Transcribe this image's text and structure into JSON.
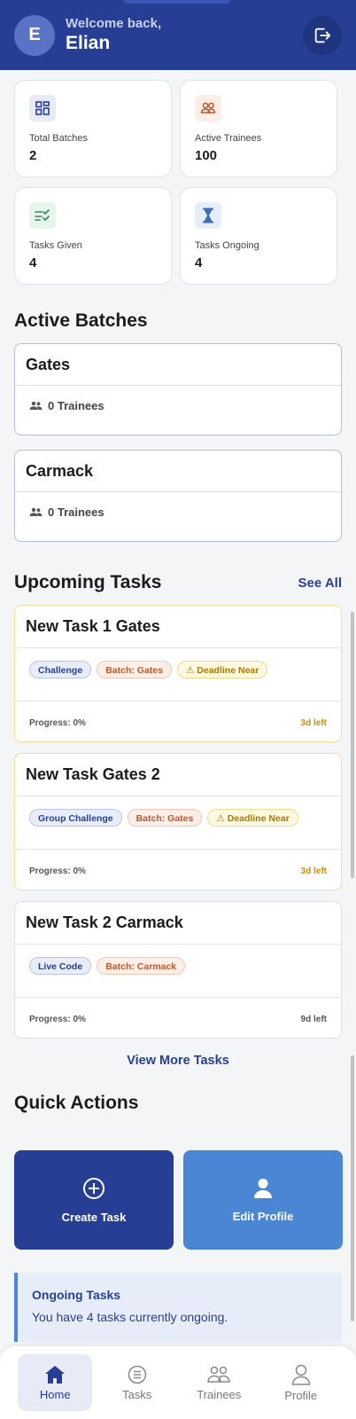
{
  "header": {
    "avatar_initial": "E",
    "welcome": "Welcome back,",
    "user_name": "Elian"
  },
  "stats": [
    {
      "label": "Total Batches",
      "value": "2",
      "icon": "grid-icon"
    },
    {
      "label": "Active Trainees",
      "value": "100",
      "icon": "people-icon"
    },
    {
      "label": "Tasks Given",
      "value": "4",
      "icon": "checklist-icon"
    },
    {
      "label": "Tasks Ongoing",
      "value": "4",
      "icon": "hourglass-icon"
    }
  ],
  "active_batches": {
    "title": "Active Batches",
    "items": [
      {
        "name": "Gates",
        "trainees": "0 Trainees"
      },
      {
        "name": "Carmack",
        "trainees": "0 Trainees"
      }
    ]
  },
  "upcoming_tasks": {
    "title": "Upcoming Tasks",
    "see_all": "See All",
    "items": [
      {
        "name": "New Task 1 Gates",
        "type": "Challenge",
        "batch": "Batch: Gates",
        "deadline": "⚠ Deadline Near",
        "progress": "Progress: 0%",
        "time_left": "3d left"
      },
      {
        "name": "New Task Gates 2",
        "type": "Group Challenge",
        "batch": "Batch: Gates",
        "deadline": "⚠ Deadline Near",
        "progress": "Progress: 0%",
        "time_left": "3d left"
      },
      {
        "name": "New Task 2 Carmack",
        "type": "Live Code",
        "batch": "Batch: Carmack",
        "progress": "Progress: 0%",
        "time_left": "9d left"
      }
    ],
    "view_more": "View More Tasks"
  },
  "quick_actions": {
    "title": "Quick Actions",
    "create_task": "Create Task",
    "edit_profile": "Edit Profile"
  },
  "ongoing_banner": {
    "title": "Ongoing Tasks",
    "text": "You have 4 tasks currently ongoing."
  },
  "nav": [
    {
      "label": "Home",
      "icon": "home-icon"
    },
    {
      "label": "Tasks",
      "icon": "list-icon"
    },
    {
      "label": "Trainees",
      "icon": "people-icon"
    },
    {
      "label": "Profile",
      "icon": "person-icon"
    }
  ],
  "colors": {
    "primary": "#263f94",
    "accent": "#4a86d4",
    "warning": "#c98f00"
  }
}
